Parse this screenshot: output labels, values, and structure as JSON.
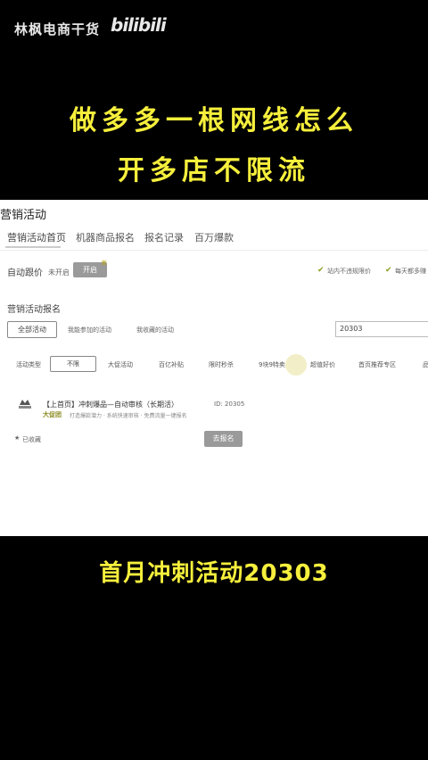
{
  "overlay": {
    "watermark_text": "林枫电商干货",
    "watermark_logo": "bilibili",
    "headline_line1": "做多多一根网线怎么",
    "headline_line2": "开多店不限流",
    "caption": "首月冲刺活动20303",
    "accent_color": "#f6ef3c"
  },
  "screen": {
    "title": "营销活动",
    "tabs": [
      {
        "label": "营销活动首页"
      },
      {
        "label": "机器商品报名"
      },
      {
        "label": "报名记录"
      },
      {
        "label": "百万爆款"
      }
    ],
    "auto_price_label": "自动跟价",
    "auto_price_status": "未开启",
    "auto_price_button": "开启",
    "new_badge": "新",
    "promo_notes": [
      "站内不违规限价",
      "每天都多赚"
    ],
    "section_title": "营销活动报名",
    "filter_all": "全部活动",
    "filter_joinable": "我能参加的活动",
    "filter_collected": "我收藏的活动",
    "search_value": "20303",
    "category_label": "活动类型",
    "category_selected": "不限",
    "categories": [
      "大促活动",
      "百亿补贴",
      "限时秒杀",
      "9块9特卖",
      "超值好价",
      "首页推荐专区",
      "品"
    ],
    "activity": {
      "brand": "大促团",
      "title": "【上首页】冲刺爆品—自动审核（长期活）",
      "id_label": "ID: 20305",
      "desc": "打造爆款潜力 · 系统快速审核 · 免费流量一键报名",
      "collected": "已收藏",
      "signup_button": "去报名"
    }
  }
}
